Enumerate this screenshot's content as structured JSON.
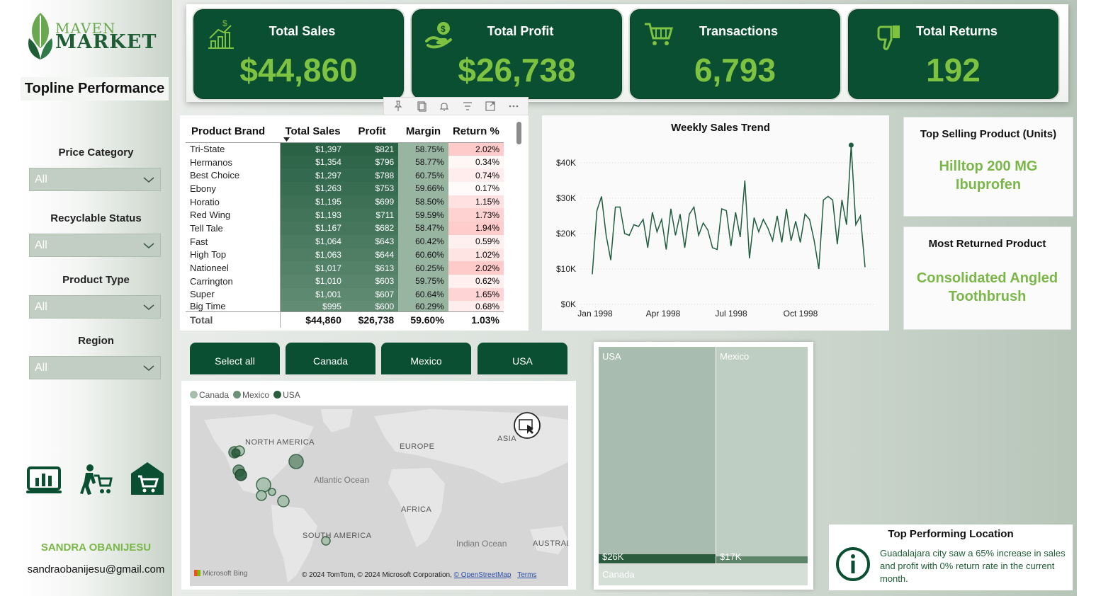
{
  "brand": {
    "line1": "MAVEN",
    "line2": "MARKET"
  },
  "page_title": "Topline Performance",
  "filters": [
    {
      "label": "Price Category",
      "value": "All"
    },
    {
      "label": "Recyclable Status",
      "value": "All"
    },
    {
      "label": "Product Type",
      "value": "All"
    },
    {
      "label": "Region",
      "value": "All"
    }
  ],
  "nav_icons": [
    "bar-chart-icon",
    "shopping-cart-person-icon",
    "store-icon"
  ],
  "author": {
    "name": "SANDRA OBANIJESU",
    "email": "sandraobanijesu@gmail.com"
  },
  "kpis": [
    {
      "title": "Total Sales",
      "value": "$44,860",
      "icon": "sales-growth-icon"
    },
    {
      "title": "Total Profit",
      "value": "$26,738",
      "icon": "money-hand-icon"
    },
    {
      "title": "Transactions",
      "value": "6,793",
      "icon": "shopping-cart-icon"
    },
    {
      "title": "Total Returns",
      "value": "192",
      "icon": "thumbs-down-icon"
    }
  ],
  "table": {
    "headers": [
      "Product Brand",
      "Total Sales",
      "Profit",
      "Margin",
      "Return %"
    ],
    "rows": [
      [
        "Tri-State",
        "$1,397",
        "$821",
        "58.75%",
        "2.02%"
      ],
      [
        "Hermanos",
        "$1,354",
        "$796",
        "58.77%",
        "0.34%"
      ],
      [
        "Best Choice",
        "$1,297",
        "$788",
        "60.75%",
        "0.74%"
      ],
      [
        "Ebony",
        "$1,263",
        "$753",
        "59.66%",
        "0.17%"
      ],
      [
        "Horatio",
        "$1,195",
        "$699",
        "58.50%",
        "1.15%"
      ],
      [
        "Red Wing",
        "$1,193",
        "$711",
        "59.59%",
        "1.73%"
      ],
      [
        "Tell Tale",
        "$1,167",
        "$682",
        "58.47%",
        "1.94%"
      ],
      [
        "Fast",
        "$1,064",
        "$643",
        "60.42%",
        "0.59%"
      ],
      [
        "High Top",
        "$1,063",
        "$644",
        "60.60%",
        "1.02%"
      ],
      [
        "Nationeel",
        "$1,017",
        "$613",
        "60.25%",
        "2.02%"
      ],
      [
        "Carrington",
        "$1,010",
        "$603",
        "59.75%",
        "0.62%"
      ],
      [
        "Super",
        "$1,001",
        "$607",
        "60.64%",
        "1.65%"
      ],
      [
        "Big Time",
        "$995",
        "$600",
        "60.29%",
        "0.68%"
      ]
    ],
    "total": [
      "Total",
      "$44,860",
      "$26,738",
      "59.60%",
      "1.03%"
    ]
  },
  "chart_data": {
    "type": "line",
    "title": "Weekly Sales Trend",
    "xlabel": "",
    "ylabel": "",
    "x_tick_labels": [
      "Jan 1998",
      "Apr 1998",
      "Jul 1998",
      "Oct 1998"
    ],
    "y_tick_labels": [
      "$0K",
      "$10K",
      "$20K",
      "$30K",
      "$40K"
    ],
    "ylim": [
      0,
      40000
    ],
    "grid": true,
    "series": [
      {
        "values": [
          8500,
          26500,
          30500,
          19500,
          12500,
          27500,
          27500,
          20000,
          19500,
          22500,
          22000,
          24000,
          16000,
          26000,
          20500,
          24000,
          15500,
          27000,
          19500,
          25500,
          16000,
          25500,
          27500,
          19500,
          23000,
          21000,
          16000,
          15500,
          27000,
          26500,
          16500,
          26000,
          19000,
          35000,
          13000,
          24500,
          20500,
          24000,
          21500,
          18000,
          25000,
          17500,
          27000,
          18000,
          23500,
          17500,
          25500,
          24000,
          18000,
          10000,
          29500,
          30500,
          29500,
          17000,
          29500,
          22500,
          45000,
          22500,
          25000,
          10500
        ]
      }
    ]
  },
  "top_selling": {
    "title": "Top Selling Product (Units)",
    "value_line1": "Hilltop 200 MG",
    "value_line2": "Ibuprofen"
  },
  "most_returned": {
    "title": "Most Returned Product",
    "value_line1": "Consolidated Angled",
    "value_line2": "Toothbrush"
  },
  "region_buttons": [
    "Select all",
    "Canada",
    "Mexico",
    "USA"
  ],
  "map": {
    "legend": [
      "Canada",
      "Mexico",
      "USA"
    ],
    "colors": {
      "Canada": "#a6beab",
      "Mexico": "#6e9278",
      "USA": "#2b5c3d"
    },
    "labels": [
      "NORTH AMERICA",
      "EUROPE",
      "ASIA",
      "AFRICA",
      "SOUTH AMERICA",
      "AUSTRAL"
    ],
    "oceans": [
      "Atlantic Ocean",
      "Indian Ocean"
    ],
    "credit": "© 2024 TomTom, © 2024 Microsoft Corporation,",
    "credit_link": "© OpenStreetMap",
    "terms": "Terms",
    "provider": "Microsoft Bing"
  },
  "treemap": {
    "tiles": [
      {
        "name": "USA",
        "value_label": "$26K"
      },
      {
        "name": "Mexico",
        "value_label": "$17K"
      },
      {
        "name": "Canada",
        "value_label": ""
      }
    ]
  },
  "top_location": {
    "title": "Top Performing Location",
    "text": "Guadalajara city saw a 65% increase in sales and profit with 0% return rate in the current month."
  }
}
